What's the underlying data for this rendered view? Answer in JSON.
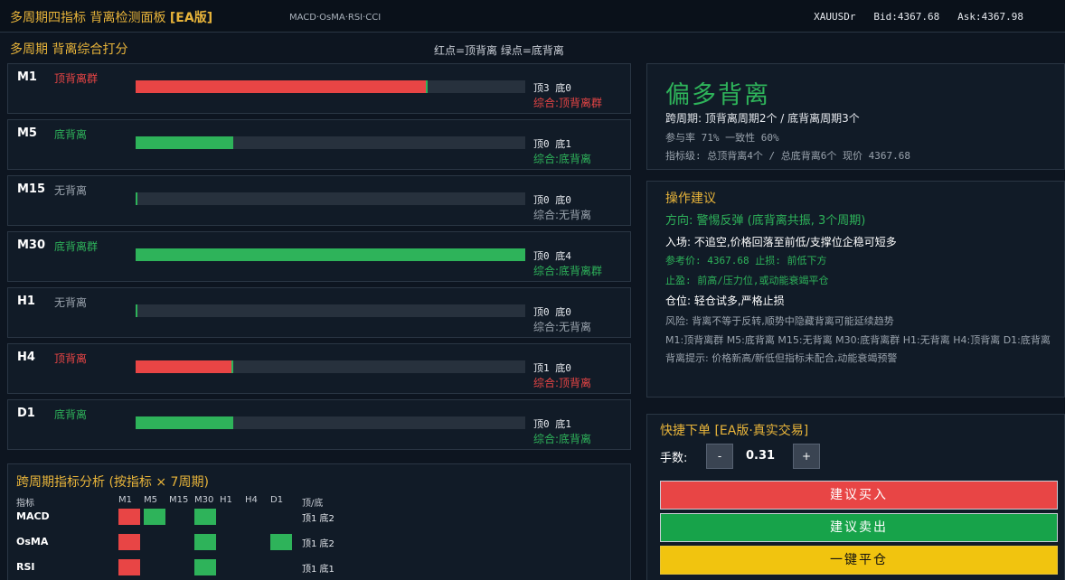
{
  "header": {
    "title": "多周期四指标 背离检测面板",
    "badge": "[EA版]",
    "subtitle": "MACD·OsMA·RSI·CCI",
    "symbol": "XAUUSDr",
    "bid": "Bid:4367.68",
    "ask": "Ask:4367.98"
  },
  "scoring": {
    "title": "多周期 背离综合打分",
    "legend": "红点=顶背离 绿点=底背离"
  },
  "colors": {
    "red": "#e84545",
    "green": "#2eb35a",
    "gold": "#e8b43a",
    "bar_bg": "#27313d"
  },
  "timeframes": [
    {
      "tf": "M1",
      "label": "顶背离群",
      "kind": "red",
      "fill_pct": 75,
      "counts": "顶3 底0",
      "summary": "综合:顶背离群"
    },
    {
      "tf": "M5",
      "label": "底背离",
      "kind": "green",
      "fill_pct": 25,
      "counts": "顶0 底1",
      "summary": "综合:底背离"
    },
    {
      "tf": "M15",
      "label": "无背离",
      "kind": "none",
      "fill_pct": 0,
      "counts": "顶0 底0",
      "summary": "综合:无背离"
    },
    {
      "tf": "M30",
      "label": "底背离群",
      "kind": "green",
      "fill_pct": 100,
      "counts": "顶0 底4",
      "summary": "综合:底背离群"
    },
    {
      "tf": "H1",
      "label": "无背离",
      "kind": "none",
      "fill_pct": 0,
      "counts": "顶0 底0",
      "summary": "综合:无背离"
    },
    {
      "tf": "H4",
      "label": "顶背离",
      "kind": "red",
      "fill_pct": 25,
      "counts": "顶1 底0",
      "summary": "综合:顶背离"
    },
    {
      "tf": "D1",
      "label": "底背离",
      "kind": "green",
      "fill_pct": 25,
      "counts": "顶0 底1",
      "summary": "综合:底背离"
    }
  ],
  "matrix": {
    "title": "跨周期指标分析 (按指标 × 7周期)",
    "row_header": "指标",
    "count_header": "顶/底",
    "columns": [
      "M1",
      "M5",
      "M15",
      "M30",
      "H1",
      "H4",
      "D1"
    ],
    "rows": [
      {
        "name": "MACD",
        "cells": [
          "red",
          "green",
          "",
          "green",
          "",
          "",
          ""
        ],
        "counts": "顶1 底2"
      },
      {
        "name": "OsMA",
        "cells": [
          "red",
          "",
          "",
          "green",
          "",
          "",
          "green"
        ],
        "counts": "顶1 底2"
      },
      {
        "name": "RSI",
        "cells": [
          "red",
          "",
          "",
          "green",
          "",
          "",
          ""
        ],
        "counts": "顶1 底1"
      }
    ]
  },
  "summary": {
    "bias": "偏多背离",
    "cross_period": "跨周期: 顶背离周期2个 / 底背离周期3个",
    "rates": "参与率 71%    一致性 60%",
    "indicator_level": "指标级: 总顶背离4个 / 总底背离6个    现价 4367.68"
  },
  "advice": {
    "title": "操作建议",
    "direction": "方向: 警惕反弹 (底背离共振, 3个周期)",
    "entry": "入场: 不追空,价格回落至前低/支撑位企稳可短多",
    "reference": "参考价: 4367.68  止损: 前低下方",
    "take_profit": "止盈: 前高/压力位,或动能衰竭平仓",
    "position": "仓位: 轻仓试多,严格止损",
    "risk": "风险: 背离不等于反转,顺势中隐藏背离可能延续趋势",
    "tf_summary": "M1:顶背离群  M5:底背离  M15:无背离  M30:底背离群  H1:无背离  H4:顶背离  D1:底背离",
    "hint": "背离提示: 价格新高/新低但指标未配合,动能衰竭预警"
  },
  "order": {
    "title": "快捷下单",
    "title_badge": "[EA版·真实交易]",
    "lot_label": "手数:",
    "minus": "-",
    "lot": "0.31",
    "plus": "+",
    "buy": "建议买入",
    "sell": "建议卖出",
    "close_all": "一键平仓",
    "buy_color": "#e84545",
    "sell_color": "#17a34a",
    "close_color": "#f1c40f"
  }
}
